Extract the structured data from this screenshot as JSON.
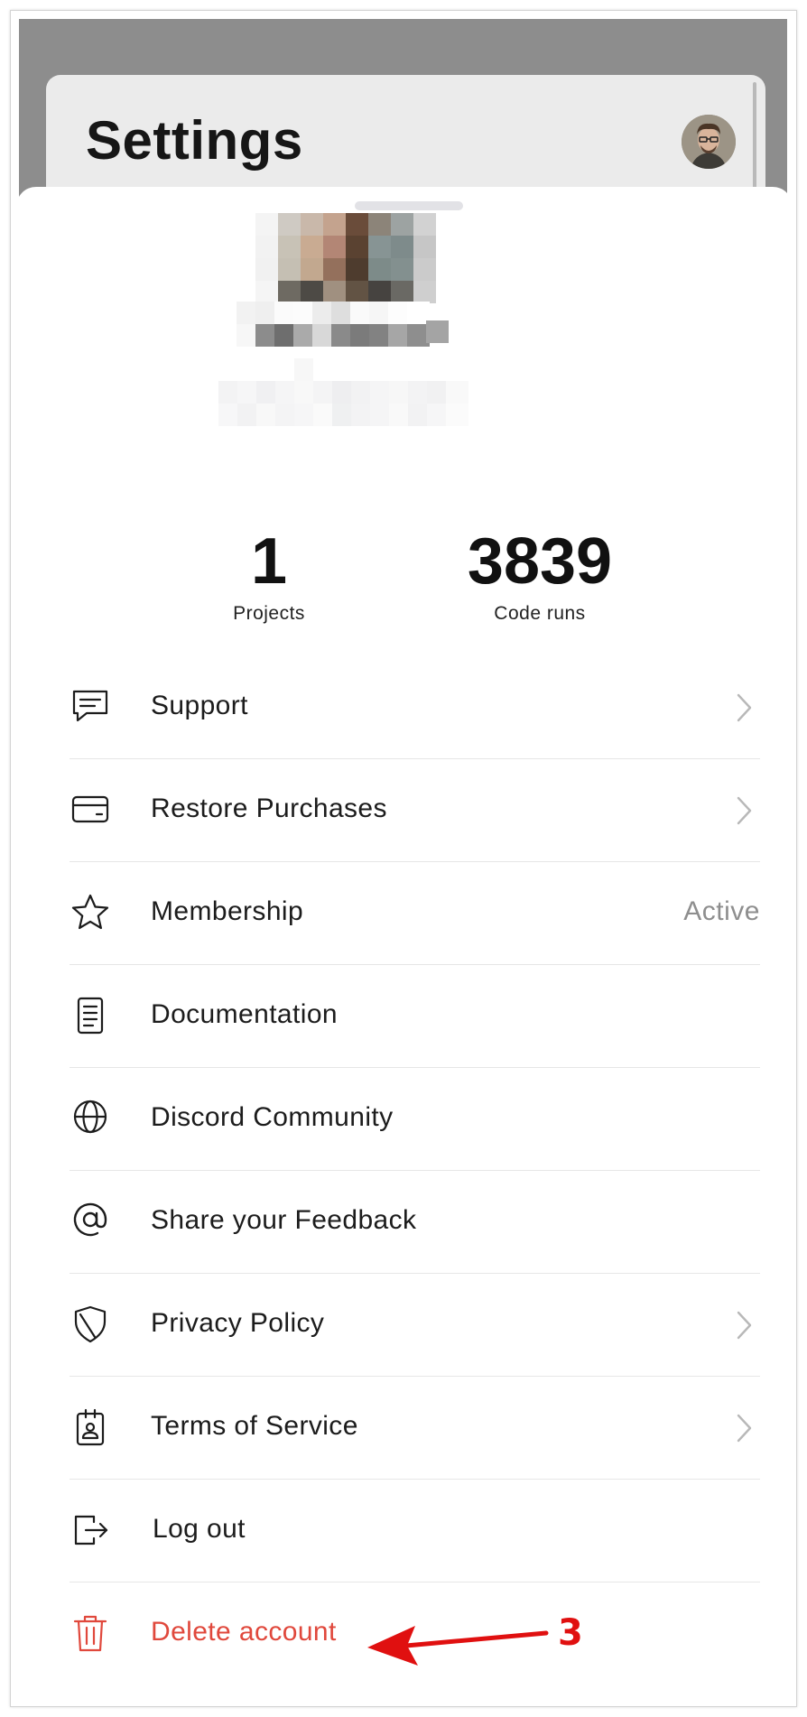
{
  "header": {
    "title": "Settings"
  },
  "profile": {
    "projects": {
      "value": "1",
      "label": "Projects"
    },
    "code_runs": {
      "value": "3839",
      "label": "Code runs"
    }
  },
  "menu": [
    {
      "label": "Support",
      "icon": "chat-icon",
      "accessory": "chevron"
    },
    {
      "label": "Restore Purchases",
      "icon": "card-icon",
      "accessory": "chevron"
    },
    {
      "label": "Membership",
      "icon": "star-icon",
      "value": "Active"
    },
    {
      "label": "Documentation",
      "icon": "document-icon"
    },
    {
      "label": "Discord Community",
      "icon": "globe-icon"
    },
    {
      "label": "Share your Feedback",
      "icon": "at-icon"
    },
    {
      "label": "Privacy Policy",
      "icon": "shield-icon",
      "accessory": "chevron"
    },
    {
      "label": "Terms of Service",
      "icon": "badge-icon",
      "accessory": "chevron"
    },
    {
      "label": "Log out",
      "icon": "logout-icon"
    },
    {
      "label": "Delete account",
      "icon": "trash-icon",
      "danger": true
    }
  ],
  "annotation": {
    "step_number": "3",
    "color": "#e01010"
  },
  "colors": {
    "danger": "#e0483c",
    "backdrop": "#8d8d8d",
    "accent_text": "#1c1c1c"
  }
}
